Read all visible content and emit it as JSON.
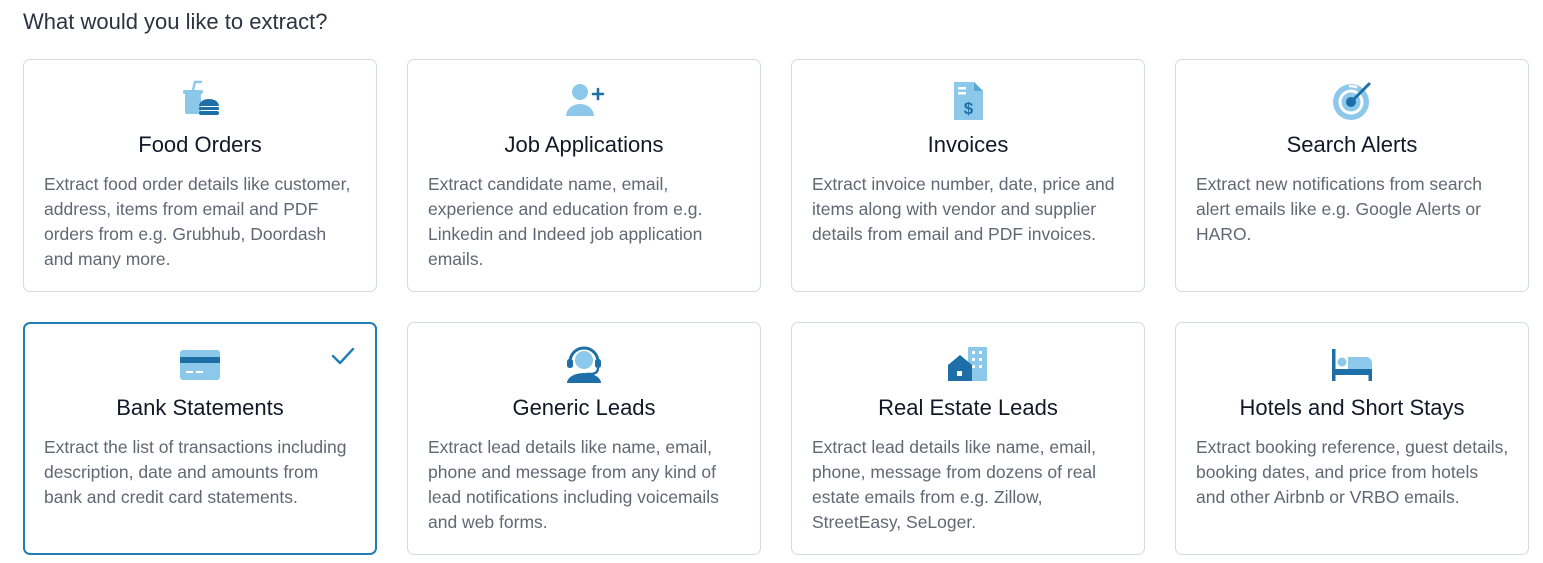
{
  "page": {
    "title": "What would you like to extract?"
  },
  "colors": {
    "accent": "#1f7fb5",
    "icon_light": "#8cc8ea",
    "icon_dark": "#1e6fa8",
    "border": "#d6dbe1",
    "desc_text": "#5f6873"
  },
  "cards": [
    {
      "icon": "food-order-icon",
      "title": "Food Orders",
      "description": "Extract food order details like customer, address, items from email and PDF orders from e.g. Grubhub, Doordash and many more.",
      "selected": false
    },
    {
      "icon": "add-user-icon",
      "title": "Job Applications",
      "description": "Extract candidate name, email, experience and education from e.g. Linkedin and Indeed job application emails.",
      "selected": false
    },
    {
      "icon": "invoice-icon",
      "title": "Invoices",
      "description": "Extract invoice number, date, price and items along with vendor and supplier details from email and PDF invoices.",
      "selected": false
    },
    {
      "icon": "radar-icon",
      "title": "Search Alerts",
      "description": "Extract new notifications from search alert emails like e.g. Google Alerts or HARO.",
      "selected": false
    },
    {
      "icon": "credit-card-icon",
      "title": "Bank Statements",
      "description": "Extract the list of transactions including description, date and amounts from bank and credit card statements.",
      "selected": true
    },
    {
      "icon": "headset-agent-icon",
      "title": "Generic Leads",
      "description": "Extract lead details like name, email, phone and message from any kind of lead notifications including voicemails and web forms.",
      "selected": false
    },
    {
      "icon": "buildings-icon",
      "title": "Real Estate Leads",
      "description": "Extract lead details like name, email, phone, message from dozens of real estate emails from e.g. Zillow, StreetEasy, SeLoger.",
      "selected": false
    },
    {
      "icon": "bed-icon",
      "title": "Hotels and Short Stays",
      "description": "Extract booking reference, guest details, booking dates, and price from hotels and other Airbnb or VRBO emails.",
      "selected": false
    }
  ]
}
